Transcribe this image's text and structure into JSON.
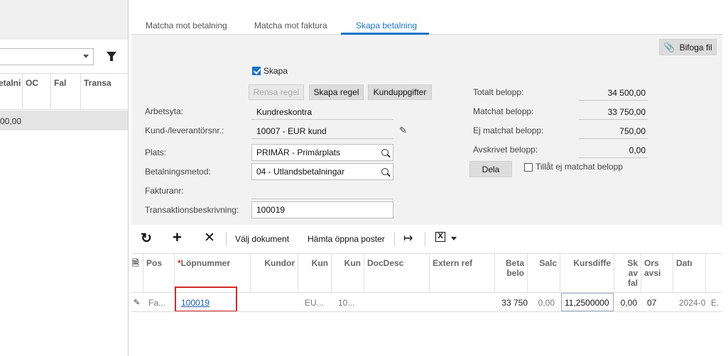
{
  "left_pane": {
    "columns": [
      "etalni",
      "OC",
      "Fal",
      "Transa"
    ],
    "row_value": "00,00"
  },
  "tabs": [
    {
      "label": "Matcha mot betalning"
    },
    {
      "label": "Matcha mot faktura"
    },
    {
      "label": "Skapa betalning"
    }
  ],
  "attach_button": "Bifoga fil",
  "create_checkbox": {
    "label": "Skapa",
    "checked": true
  },
  "rule_buttons": {
    "reset": "Rensa regel",
    "create": "Skapa regel",
    "customer_info": "Kunduppgifter"
  },
  "form": {
    "workspace": {
      "label": "Arbetsyta:",
      "value": "Kundreskontra"
    },
    "customer": {
      "label": "Kund-/leverantörsnr.:",
      "value": "10007 - EUR kund"
    },
    "location": {
      "label": "Plats:",
      "value": "PRIMÄR - Primärplats"
    },
    "payment_method": {
      "label": "Betalningsmetod:",
      "value": "04 - Utlandsbetalningar"
    },
    "invoice_no": {
      "label": "Fakturanr:",
      "value": ""
    },
    "transaction_desc": {
      "label": "Transaktionsbeskrivning:",
      "value": "100019"
    }
  },
  "summary": {
    "total": {
      "label": "Totalt belopp:",
      "value": "34 500,00"
    },
    "matched": {
      "label": "Matchat belopp:",
      "value": "33 750,00"
    },
    "unmatched": {
      "label": "Ej matchat belopp:",
      "value": "750,00"
    },
    "written_off": {
      "label": "Avskrivet belopp:",
      "value": "0,00"
    },
    "split_button": "Dela",
    "allow_unmatched": {
      "label": "Tillåt ej matchat belopp",
      "checked": false
    }
  },
  "toolbar": {
    "select_document": "Välj dokument",
    "fetch_open": "Hämta öppna poster"
  },
  "grid": {
    "headers": {
      "pos": "Pos",
      "required_mark": "*",
      "lopnummer": "Löpnummer",
      "kundord": "Kundor",
      "kun1": "Kun",
      "kun2": "Kun",
      "docdesc": "DocDesc",
      "extref": "Extern ref",
      "beta_l1": "Beta",
      "beta_l2": "belo",
      "saldo": "Salc",
      "kursdiff": "Kursdiffe",
      "sk_l1": "Sk",
      "sk_l2": "av",
      "sk_l3": "fal",
      "ors_l1": "Ors",
      "ors_l2": "avsi",
      "datum": "Datı"
    },
    "row": {
      "pos": "Fa...",
      "lopnummer": "100019",
      "kun1": "EU...",
      "kun2": "10...",
      "belopp": "33 750",
      "saldo": "0,00",
      "kursdiff": "11,2500000",
      "sk": "0,00",
      "ors": "07",
      "datum": "2024-0",
      "last": "E."
    }
  },
  "colors": {
    "accent": "#1a73c8",
    "highlight_box": "#d62828"
  }
}
